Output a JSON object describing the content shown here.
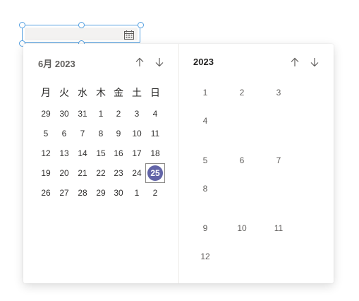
{
  "date_field": {
    "value": "",
    "icon": "calendar-icon"
  },
  "day_picker": {
    "title": "6月 2023",
    "prev_icon": "arrow-up-icon",
    "next_icon": "arrow-down-icon",
    "weekdays": [
      "月",
      "火",
      "水",
      "木",
      "金",
      "土",
      "日"
    ],
    "weeks": [
      [
        "29",
        "30",
        "31",
        "1",
        "2",
        "3",
        "4"
      ],
      [
        "5",
        "6",
        "7",
        "8",
        "9",
        "10",
        "11"
      ],
      [
        "12",
        "13",
        "14",
        "15",
        "16",
        "17",
        "18"
      ],
      [
        "19",
        "20",
        "21",
        "22",
        "23",
        "24",
        "25"
      ],
      [
        "26",
        "27",
        "28",
        "29",
        "30",
        "1",
        "2"
      ]
    ],
    "selected_day": "25"
  },
  "month_picker": {
    "title": "2023",
    "prev_icon": "arrow-up-icon",
    "next_icon": "arrow-down-icon",
    "months": [
      "1",
      "2",
      "3",
      "4",
      "5",
      "6",
      "7",
      "8",
      "9",
      "10",
      "11",
      "12"
    ]
  },
  "colors": {
    "accent": "#6264a7",
    "selection_outline": "#55a0e0"
  }
}
